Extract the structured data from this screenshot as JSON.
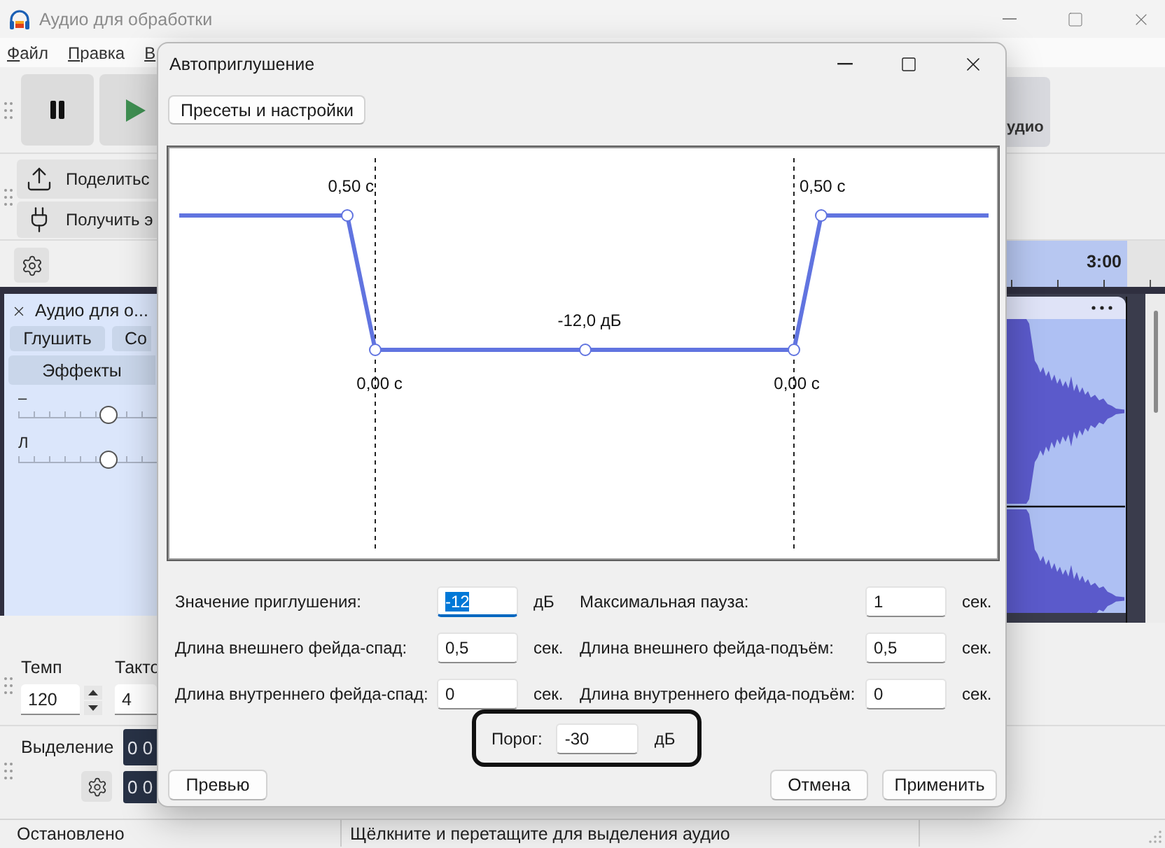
{
  "app": {
    "title": "Аудио для обработки",
    "menu": [
      {
        "label": "Файл"
      },
      {
        "label": "Правка"
      },
      {
        "label": "В"
      }
    ],
    "toolbar_button": "удио",
    "tools": [
      {
        "kind": "share",
        "label": "Поделитьс"
      },
      {
        "kind": "plug",
        "label": "Получить э"
      }
    ],
    "ruler": {
      "time": "3:00"
    },
    "track": {
      "name": "Аудио для о...",
      "buttons": [
        {
          "label": "Глушить"
        },
        {
          "label": "Со"
        }
      ],
      "effects_button": "Эффекты",
      "sliders": [
        {
          "label": "–",
          "level": 0.65
        },
        {
          "label": "Л",
          "level": 0.65
        }
      ]
    },
    "tempo": {
      "label": "Темп",
      "value": "120"
    },
    "time_signature": {
      "label": "Такто",
      "value": "4"
    },
    "selection": {
      "label": "Выделение",
      "times": [
        "0 0",
        "0 0"
      ]
    },
    "status_bar": [
      "Остановлено",
      "Щёлкните и перетащите для выделения аудио"
    ]
  },
  "dialog": {
    "title": "Автоприглушение",
    "presets_button": "Пресеты и настройки",
    "envelope": {
      "top_left_label": "0,50 с",
      "bottom_left_label": "0,00 с",
      "center_label": "-12,0 дБ",
      "bottom_right_label": "0,00 с",
      "top_right_label": "0,50 с"
    },
    "fields": [
      {
        "label": "Значение приглушения:",
        "value": "-12",
        "unit": "дБ",
        "focused": true
      },
      {
        "label": "Максимальная пауза:",
        "value": "1",
        "unit": "сек.",
        "focused": false
      },
      {
        "label": "Длина внешнего фейда-спад:",
        "value": "0,5",
        "unit": "сек.",
        "focused": false
      },
      {
        "label": "Длина внешнего фейда-подъём:",
        "value": "0,5",
        "unit": "сек.",
        "focused": false
      },
      {
        "label": "Длина внутреннего фейда-спад:",
        "value": "0",
        "unit": "сек.",
        "focused": false
      },
      {
        "label": "Длина внутреннего фейда-подъём:",
        "value": "0",
        "unit": "сек.",
        "focused": false
      }
    ],
    "threshold": {
      "label": "Порог:",
      "value": "-30",
      "unit": "дБ",
      "highlighted": true
    },
    "preview_button": "Превью",
    "buttons": [
      {
        "label": "Отмена"
      },
      {
        "label": "Применить"
      }
    ]
  }
}
